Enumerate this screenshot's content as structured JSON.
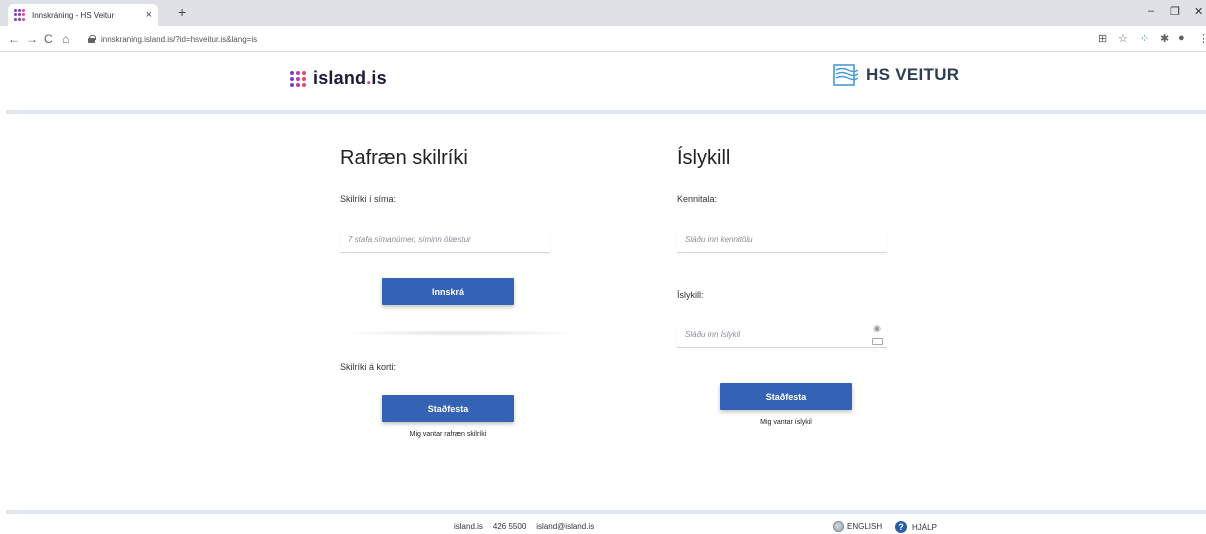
{
  "browser": {
    "tab_title": "Innskráning - HS Veitur",
    "tab_close": "×",
    "new_tab": "+",
    "url": "innskraning.island.is/?id=hsveitur.is&lang=is",
    "nav": {
      "back": "←",
      "forward": "→",
      "reload": "C",
      "home": "⌂"
    },
    "window": {
      "minimize": "–",
      "restore": "❐",
      "close": "✕"
    },
    "extensions": [
      "⊞",
      "☆",
      "⁘",
      "✱",
      "●",
      "⋮"
    ]
  },
  "header": {
    "island_brand": "island",
    "island_dot": ".",
    "island_tld": "is",
    "hs_brand": "HS VEITUR"
  },
  "left": {
    "title": "Rafræn skilríki",
    "phone_label": "Skilríki í síma:",
    "phone_placeholder": "7 stafa símanúmer, síminn ólæstur",
    "login_button": "Innskrá",
    "card_label": "Skilríki á korti:",
    "confirm_button": "Staðfesta",
    "need_link": "Mig vantar rafræn skilríki"
  },
  "right": {
    "title": "Íslykill",
    "kt_label": "Kennitala:",
    "kt_placeholder": "Sláðu inn kennitölu",
    "key_label": "Íslykill:",
    "key_placeholder": "Sláðu inn Íslykil",
    "confirm_button": "Staðfesta",
    "need_link": "Mig vantar íslykil"
  },
  "footer": {
    "site": "island.is",
    "phone": "426 5500",
    "email": "island@island.is",
    "english": "ENGLISH",
    "help": "HJÁLP",
    "help_icon_glyph": "?"
  },
  "colors": {
    "button": "#3463b5",
    "brand_purple": "#7b3fbf",
    "brand_pink": "#e24a6a"
  },
  "icons": {
    "eye": "◉"
  }
}
